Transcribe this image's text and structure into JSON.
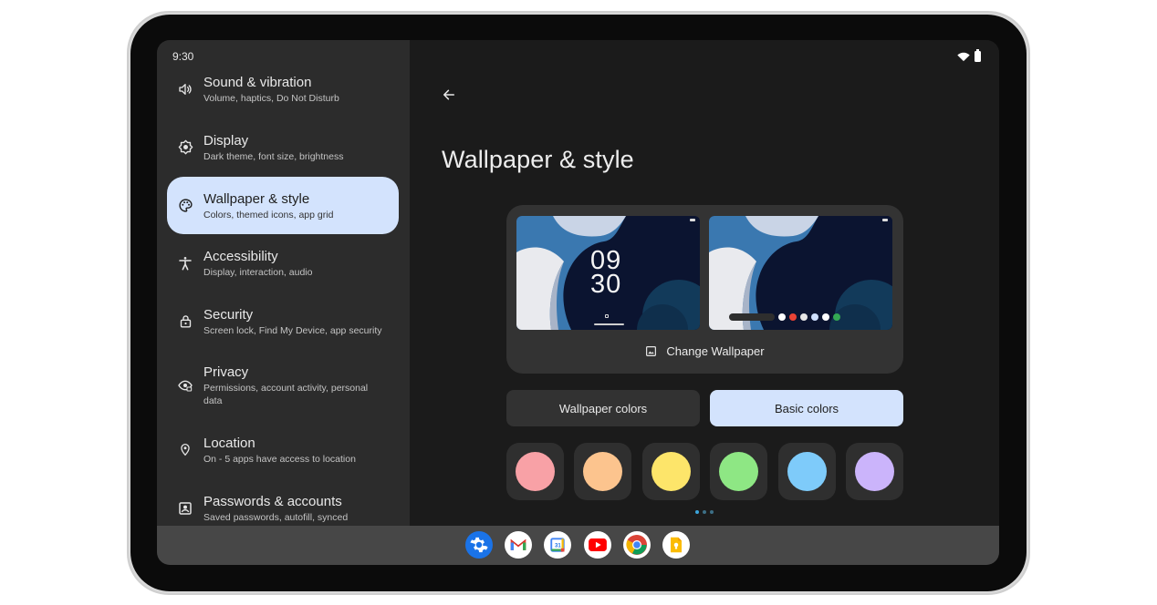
{
  "status_bar": {
    "time": "9:30",
    "icons": [
      "wifi-icon",
      "battery-icon"
    ]
  },
  "sidebar": {
    "items": [
      {
        "title": "Sound & vibration",
        "subtitle": "Volume, haptics, Do Not Disturb",
        "icon": "speaker-icon",
        "active": false
      },
      {
        "title": "Display",
        "subtitle": "Dark theme, font size, brightness",
        "icon": "brightness-icon",
        "active": false
      },
      {
        "title": "Wallpaper & style",
        "subtitle": "Colors, themed icons, app grid",
        "icon": "palette-icon",
        "active": true
      },
      {
        "title": "Accessibility",
        "subtitle": "Display, interaction, audio",
        "icon": "accessibility-icon",
        "active": false
      },
      {
        "title": "Security",
        "subtitle": "Screen lock, Find My Device, app security",
        "icon": "lock-icon",
        "active": false
      },
      {
        "title": "Privacy",
        "subtitle": "Permissions, account activity, personal data",
        "icon": "privacy-eye-icon",
        "active": false
      },
      {
        "title": "Location",
        "subtitle": "On - 5 apps have access to location",
        "icon": "location-pin-icon",
        "active": false
      },
      {
        "title": "Passwords & accounts",
        "subtitle": "Saved passwords, autofill, synced",
        "icon": "account-box-icon",
        "active": false
      }
    ]
  },
  "main": {
    "page_title": "Wallpaper & style",
    "preview": {
      "lock_clock_hour": "09",
      "lock_clock_minute": "30",
      "change_wallpaper_label": "Change Wallpaper"
    },
    "tabs": [
      {
        "label": "Wallpaper colors",
        "selected": false
      },
      {
        "label": "Basic colors",
        "selected": true
      }
    ],
    "color_swatches": [
      "#f8a1a6",
      "#fcc48e",
      "#fde56a",
      "#8ee784",
      "#7ecbfa",
      "#cbb4fb"
    ],
    "pager": {
      "pages": 3,
      "current": 1
    }
  },
  "taskbar": {
    "apps": [
      "settings-icon",
      "gmail-icon",
      "calendar-icon",
      "youtube-icon",
      "chrome-icon",
      "keep-icon"
    ]
  },
  "colors": {
    "accent": "#d3e3fd",
    "left_pane": "#2c2c2c",
    "right_pane": "#1b1b1b"
  }
}
